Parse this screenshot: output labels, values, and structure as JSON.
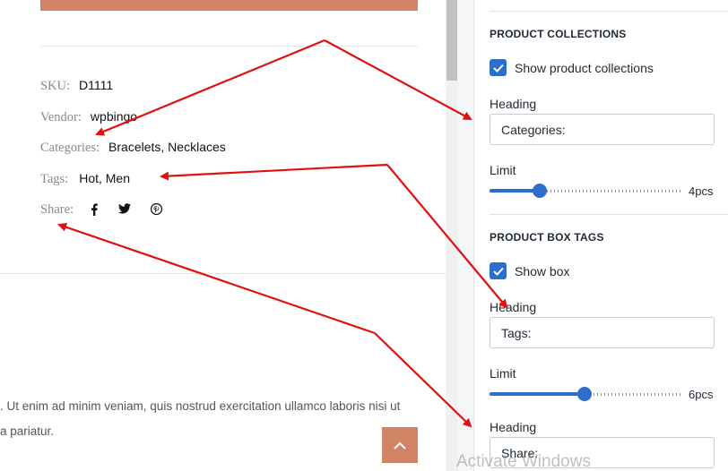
{
  "preview": {
    "meta": {
      "sku": {
        "label": "SKU:",
        "value": "D1111"
      },
      "vendor": {
        "label": "Vendor:",
        "value": "wpbingo"
      },
      "categories": {
        "label": "Categories:",
        "value": "Bracelets, Necklaces"
      },
      "tags": {
        "label": "Tags:",
        "value": "Hot, Men"
      },
      "share": {
        "label": "Share:",
        "icons": [
          "facebook-icon",
          "twitter-icon",
          "pinterest-icon"
        ]
      }
    },
    "body_lines": [
      ". Ut enim ad minim veniam, quis nostrud exercitation ullamco laboris nisi ut",
      "a pariatur."
    ],
    "accent_color": "#d08463"
  },
  "panel": {
    "collections": {
      "title": "PRODUCT COLLECTIONS",
      "checkbox_label": "Show product collections",
      "checked": true,
      "heading_label": "Heading",
      "heading_value": "Categories:",
      "limit_label": "Limit",
      "limit_value": "4pcs",
      "limit_fraction": 0.26
    },
    "tags": {
      "title": "PRODUCT BOX TAGS",
      "checkbox_label": "Show box",
      "checked": true,
      "heading_label": "Heading",
      "heading_value": "Tags:",
      "limit_label": "Limit",
      "limit_value": "6pcs",
      "limit_fraction": 0.49
    },
    "share": {
      "heading_label": "Heading",
      "heading_value": "Share:"
    },
    "accent_color": "#2c6ecb"
  },
  "watermark": "Activate Windows",
  "annotation_color": "#e01010"
}
